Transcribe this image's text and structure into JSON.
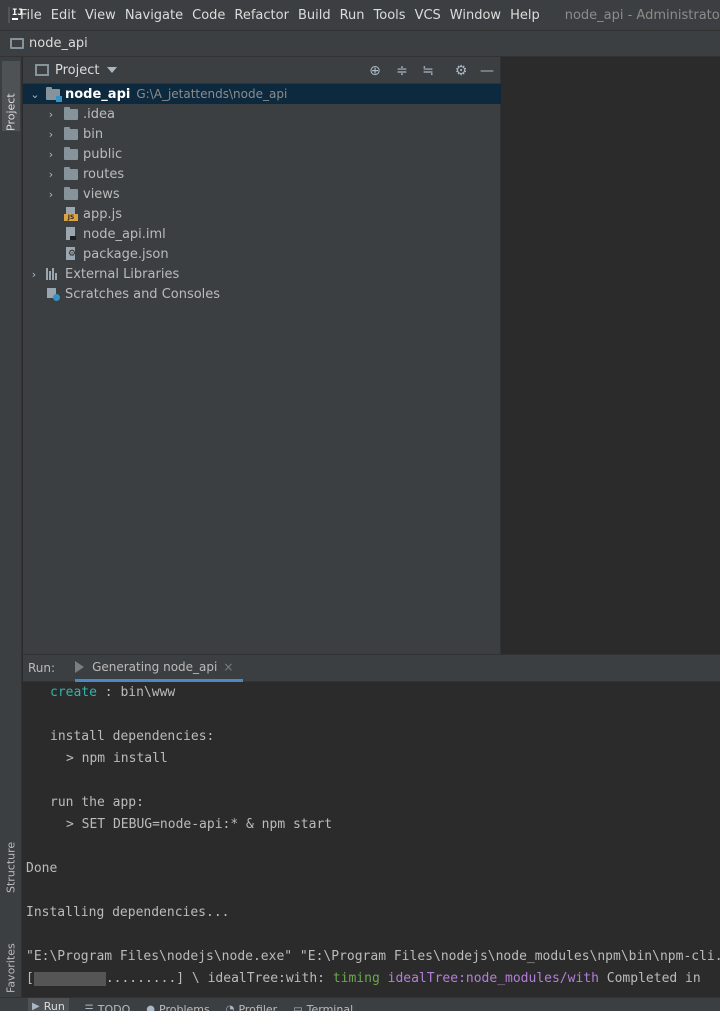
{
  "menubar": {
    "items": [
      "File",
      "Edit",
      "View",
      "Navigate",
      "Code",
      "Refactor",
      "Build",
      "Run",
      "Tools",
      "VCS",
      "Window",
      "Help"
    ],
    "window_title": "node_api - Administrator"
  },
  "navbar": {
    "project": "node_api"
  },
  "left_strip": {
    "project": "Project",
    "structure": "Structure",
    "favorites": "Favorites"
  },
  "project_panel": {
    "title": "Project",
    "root": {
      "name": "node_api",
      "path": "G:\\A_jetattends\\node_api"
    },
    "folders": [
      ".idea",
      "bin",
      "public",
      "routes",
      "views"
    ],
    "files": [
      "app.js",
      "node_api.iml",
      "package.json"
    ],
    "external_libraries": "External Libraries",
    "scratches": "Scratches and Consoles"
  },
  "run_panel": {
    "label": "Run:",
    "tab": "Generating node_api",
    "close": "×"
  },
  "console": {
    "create_kw": "create",
    "create_rest": " : bin\\www",
    "install_header": "install dependencies:",
    "install_cmd": "> npm install",
    "run_header": "run the app:",
    "run_cmd": "> SET DEBUG=node-api:* & npm start",
    "done": "Done",
    "installing": "Installing dependencies...",
    "node_cmd": "\"E:\\Program Files\\nodejs\\node.exe\" \"E:\\Program Files\\nodejs\\node_modules\\npm\\bin\\npm-cli.js\"",
    "progress_open": "[",
    "progress_dots": ".........",
    "progress_close": "] \\ idealTree:with: ",
    "timing": "timing",
    "ideal_tree": "idealTree:node_modules/with",
    "completed": " Completed in"
  },
  "bottom_bar": {
    "tabs": [
      "Run",
      "TODO",
      "Problems",
      "Profiler",
      "Terminal"
    ]
  }
}
